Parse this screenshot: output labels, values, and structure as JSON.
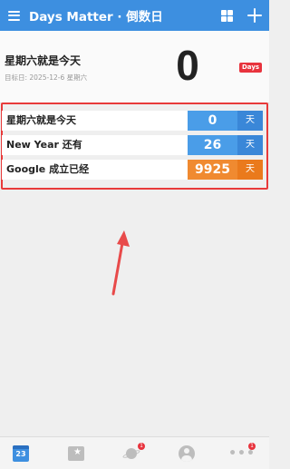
{
  "header": {
    "title": "Days Matter · 倒数日"
  },
  "hero": {
    "title": "星期六就是今天",
    "subtitle": "目标日: 2025-12-6 星期六",
    "count": "0",
    "badge": "Days"
  },
  "events": [
    {
      "label": "星期六就是今天",
      "count": "0",
      "unit": "天",
      "color": "#4a9de8",
      "unit_color": "#3a87d8"
    },
    {
      "label": "New Year 还有",
      "count": "26",
      "unit": "天",
      "color": "#4a9de8",
      "unit_color": "#3a87d8"
    },
    {
      "label": "Google 成立已经",
      "count": "9925",
      "unit": "天",
      "color": "#f08a30",
      "unit_color": "#ea7a1c"
    }
  ],
  "bottom_nav": {
    "calendar_day": "23",
    "planet_badge": "1",
    "more_badge": "1",
    "more_label": "•••"
  },
  "colors": {
    "accent": "#3d8fe0",
    "highlight_border": "#e83a3a",
    "arrow": "#e84a4a",
    "badge": "#e8333d"
  }
}
